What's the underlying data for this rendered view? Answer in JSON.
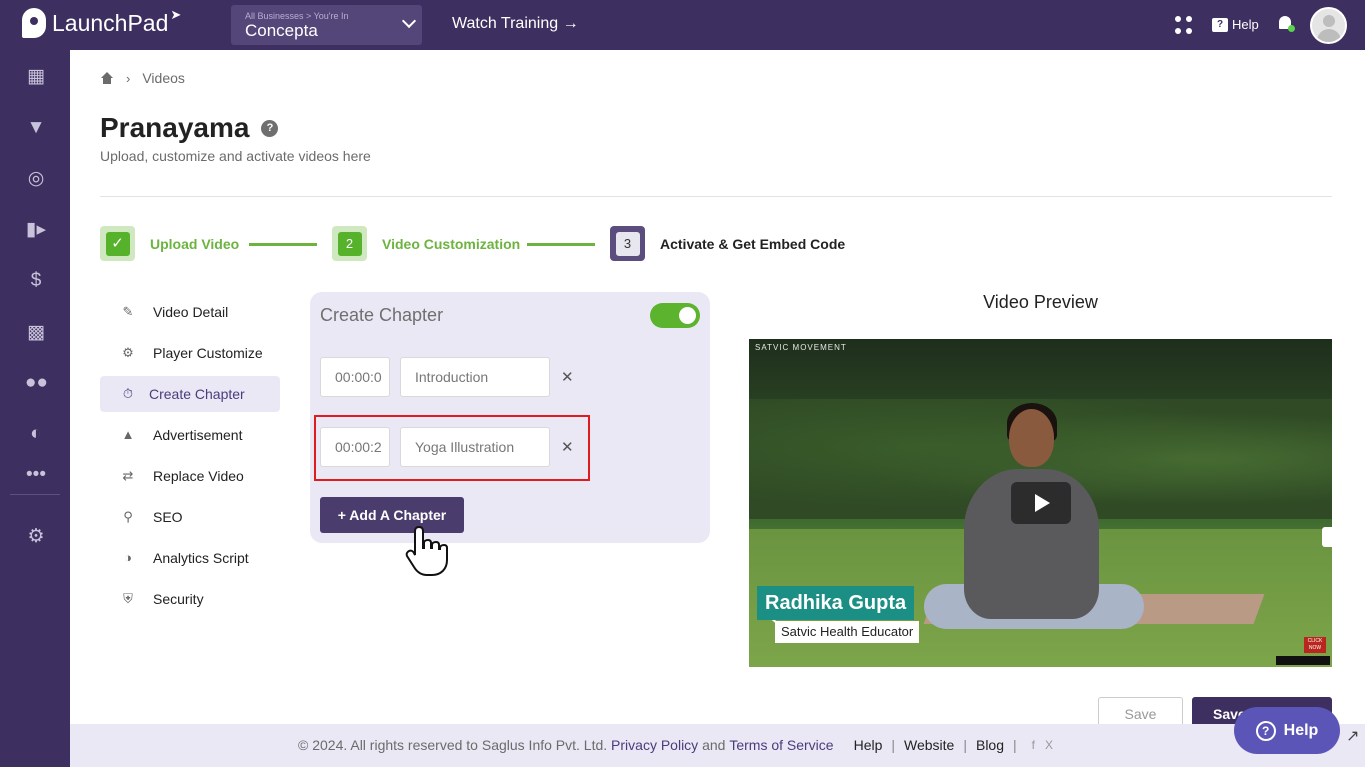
{
  "header": {
    "app_name": "LaunchPad",
    "business_crumb": "All Businesses  >  You're In",
    "business_name": "Concepta",
    "watch_training": "Watch Training →",
    "help": "Help"
  },
  "breadcrumb": {
    "current": "Videos"
  },
  "page": {
    "title": "Pranayama",
    "subtitle": "Upload, customize and activate videos here"
  },
  "steps": [
    {
      "label": "Upload Video",
      "state": "done",
      "badge": "✓"
    },
    {
      "label": "Video Customization",
      "state": "active",
      "badge": "2"
    },
    {
      "label": "Activate & Get Embed Code",
      "state": "pending",
      "badge": "3"
    }
  ],
  "menu": [
    {
      "label": "Video Detail",
      "icon": "edit-icon"
    },
    {
      "label": "Player Customize",
      "icon": "gear-icon"
    },
    {
      "label": "Create Chapter",
      "icon": "stopwatch-icon",
      "active": true
    },
    {
      "label": "Advertisement",
      "icon": "megaphone-icon"
    },
    {
      "label": "Replace Video",
      "icon": "swap-icon"
    },
    {
      "label": "SEO",
      "icon": "search-icon"
    },
    {
      "label": "Analytics Script",
      "icon": "chart-icon"
    },
    {
      "label": "Security",
      "icon": "shield-icon"
    }
  ],
  "chapter_panel": {
    "title": "Create Chapter",
    "toggle_on": true,
    "chapters": [
      {
        "time": "00:00:0",
        "name": "Introduction"
      },
      {
        "time": "00:00:2",
        "name": "Yoga Illustration"
      }
    ],
    "add_button": "+ Add A Chapter"
  },
  "preview": {
    "title": "Video Preview",
    "brand": "SATVIC MOVEMENT",
    "lower_third_name": "Radhika Gupta",
    "lower_third_role": "Satvic Health Educator",
    "click_now": "CLICK NOW"
  },
  "actions": {
    "save": "Save",
    "save_primary": "Save"
  },
  "footer": {
    "copyright": "©  2024. All rights reserved to Saglus Info Pvt. Ltd.",
    "privacy": "Privacy Policy",
    "and": "and",
    "terms": "Terms of Service",
    "help": "Help",
    "website": "Website",
    "blog": "Blog",
    "facebook": "f",
    "x": "X"
  },
  "help_widget": {
    "label": "Help"
  },
  "colors": {
    "brand": "#3d2f5f",
    "accent_green": "#6cb33f",
    "panel_bg": "#ebe8f6",
    "highlight_red": "#e01b1b"
  }
}
